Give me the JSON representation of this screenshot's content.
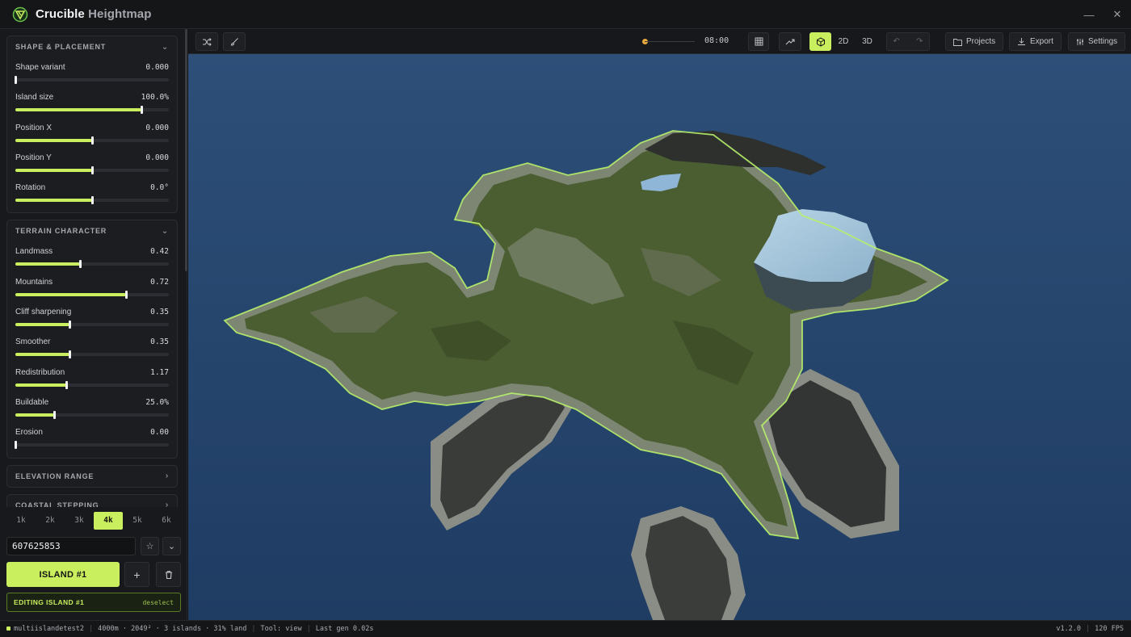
{
  "app": {
    "title_main": "Crucible",
    "title_sub": "Heightmap",
    "minimize": "—",
    "close": "✕"
  },
  "sections": [
    {
      "title": "SHAPE & PLACEMENT",
      "expanded": true,
      "sliders": [
        {
          "label": "Shape variant",
          "value": "0.000",
          "fraction": 0.0
        },
        {
          "label": "Island size",
          "value": "100.0%",
          "fraction": 0.82
        },
        {
          "label": "Position X",
          "value": "0.000",
          "fraction": 0.5
        },
        {
          "label": "Position Y",
          "value": "0.000",
          "fraction": 0.5
        },
        {
          "label": "Rotation",
          "value": "0.0°",
          "fraction": 0.5
        }
      ]
    },
    {
      "title": "TERRAIN CHARACTER",
      "expanded": true,
      "sliders": [
        {
          "label": "Landmass",
          "value": "0.42",
          "fraction": 0.42
        },
        {
          "label": "Mountains",
          "value": "0.72",
          "fraction": 0.72
        },
        {
          "label": "Cliff sharpening",
          "value": "0.35",
          "fraction": 0.35
        },
        {
          "label": "Smoother",
          "value": "0.35",
          "fraction": 0.35
        },
        {
          "label": "Redistribution",
          "value": "1.17",
          "fraction": 0.33
        },
        {
          "label": "Buildable",
          "value": "25.0%",
          "fraction": 0.25
        },
        {
          "label": "Erosion",
          "value": "0.00",
          "fraction": 0.0
        }
      ]
    },
    {
      "title": "ELEVATION RANGE",
      "expanded": false,
      "sliders": []
    },
    {
      "title": "COASTAL STEPPING",
      "expanded": false,
      "sliders": []
    }
  ],
  "resolutions": {
    "items": [
      "1k",
      "2k",
      "3k",
      "4k",
      "5k",
      "6k"
    ],
    "active": "4k"
  },
  "seed": {
    "value": "607625853",
    "favorite_icon": "☆",
    "dropdown_icon": "⌄"
  },
  "island": {
    "label": "ISLAND #1",
    "add": "+",
    "delete": "🗑"
  },
  "editing": {
    "text": "EDITING ISLAND #1",
    "deselect": "deselect"
  },
  "toolbar": {
    "time": "08:00",
    "view_2d": "2D",
    "view_3d": "3D",
    "active_view": "3D",
    "projects": "Projects",
    "export": "Export",
    "settings": "Settings"
  },
  "status": {
    "project": "multiislandetest2",
    "world": "4000m · 2049² · 3 islands · 31% land",
    "tool": "Tool: view",
    "last_gen": "Last gen 0.02s",
    "version": "v1.2.0",
    "fps": "120 FPS"
  },
  "colors": {
    "accent": "#c9ee5e",
    "ocean": "#2a4a72",
    "grass": "#4b5e32",
    "rock": "#3a3c3a",
    "snow": "#a7c7dd"
  }
}
